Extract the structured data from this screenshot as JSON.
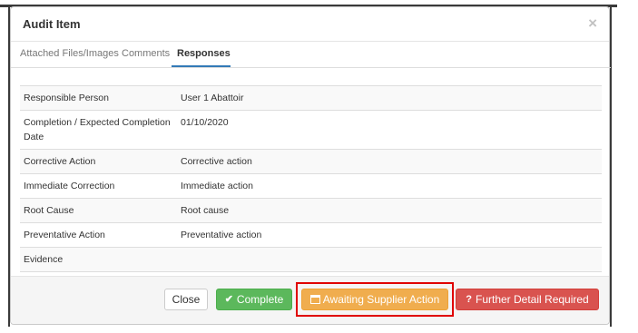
{
  "modal": {
    "title": "Audit Item",
    "close_glyph": "×"
  },
  "tabs": [
    {
      "label": "Attached Files/Images",
      "active": false
    },
    {
      "label": "Comments",
      "active": false
    },
    {
      "label": "Responses",
      "active": true
    }
  ],
  "responses": [
    {
      "key": "Responsible Person",
      "value": "User 1 Abattoir"
    },
    {
      "key": "Completion / Expected Completion Date",
      "value": "01/10/2020"
    },
    {
      "key": "Corrective Action",
      "value": "Corrective action"
    },
    {
      "key": "Immediate Correction",
      "value": "Immediate action"
    },
    {
      "key": "Root Cause",
      "value": "Root cause"
    },
    {
      "key": "Preventative Action",
      "value": "Preventative action"
    },
    {
      "key": "Evidence",
      "value": ""
    }
  ],
  "footer": {
    "close_label": "Close",
    "complete_label": "Complete",
    "awaiting_label": "Awaiting Supplier Action",
    "further_label": "Further Detail Required"
  },
  "icons": {
    "complete": "check-icon",
    "awaiting": "calendar-icon",
    "further": "question-icon"
  },
  "colors": {
    "complete": "#5cb85c",
    "awaiting": "#f0ad4e",
    "further": "#d9534f",
    "highlight": "#e00000",
    "tab_active": "#337ab7"
  }
}
